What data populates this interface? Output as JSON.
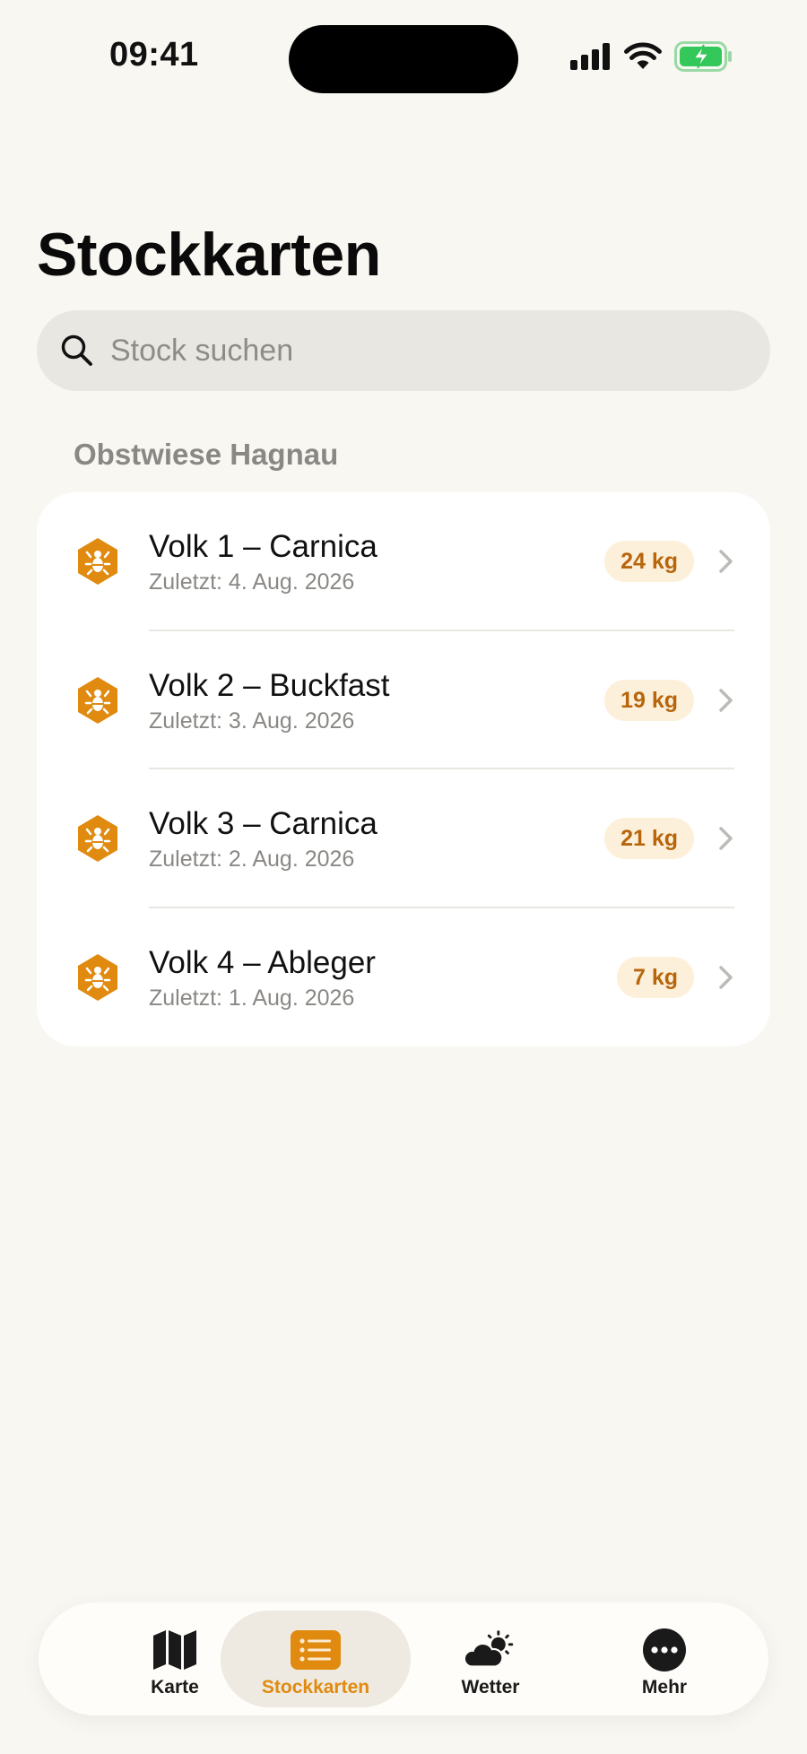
{
  "status_bar": {
    "time": "09:41"
  },
  "page": {
    "title": "Stockkarten"
  },
  "search": {
    "placeholder": "Stock suchen",
    "value": ""
  },
  "section": {
    "title": "Obstwiese Hagnau"
  },
  "hives": [
    {
      "name": "Volk 1 – Carnica",
      "last": "Zuletzt: 4. Aug. 2026",
      "weight": "24 kg"
    },
    {
      "name": "Volk 2 – Buckfast",
      "last": "Zuletzt: 3. Aug. 2026",
      "weight": "19 kg"
    },
    {
      "name": "Volk 3 – Carnica",
      "last": "Zuletzt: 2. Aug. 2026",
      "weight": "21 kg"
    },
    {
      "name": "Volk 4 – Ableger",
      "last": "Zuletzt: 1. Aug. 2026",
      "weight": "7 kg"
    }
  ],
  "tabs": [
    {
      "label": "Karte",
      "icon": "map-icon",
      "active": false
    },
    {
      "label": "Stockkarten",
      "icon": "list-icon",
      "active": true
    },
    {
      "label": "Wetter",
      "icon": "weather-icon",
      "active": false
    },
    {
      "label": "Mehr",
      "icon": "more-icon",
      "active": false
    }
  ],
  "colors": {
    "accent": "#E08A10",
    "badge_bg": "#FDF0DB",
    "badge_text": "#B7660C",
    "background": "#F9F7F2",
    "battery": "#34C759"
  }
}
